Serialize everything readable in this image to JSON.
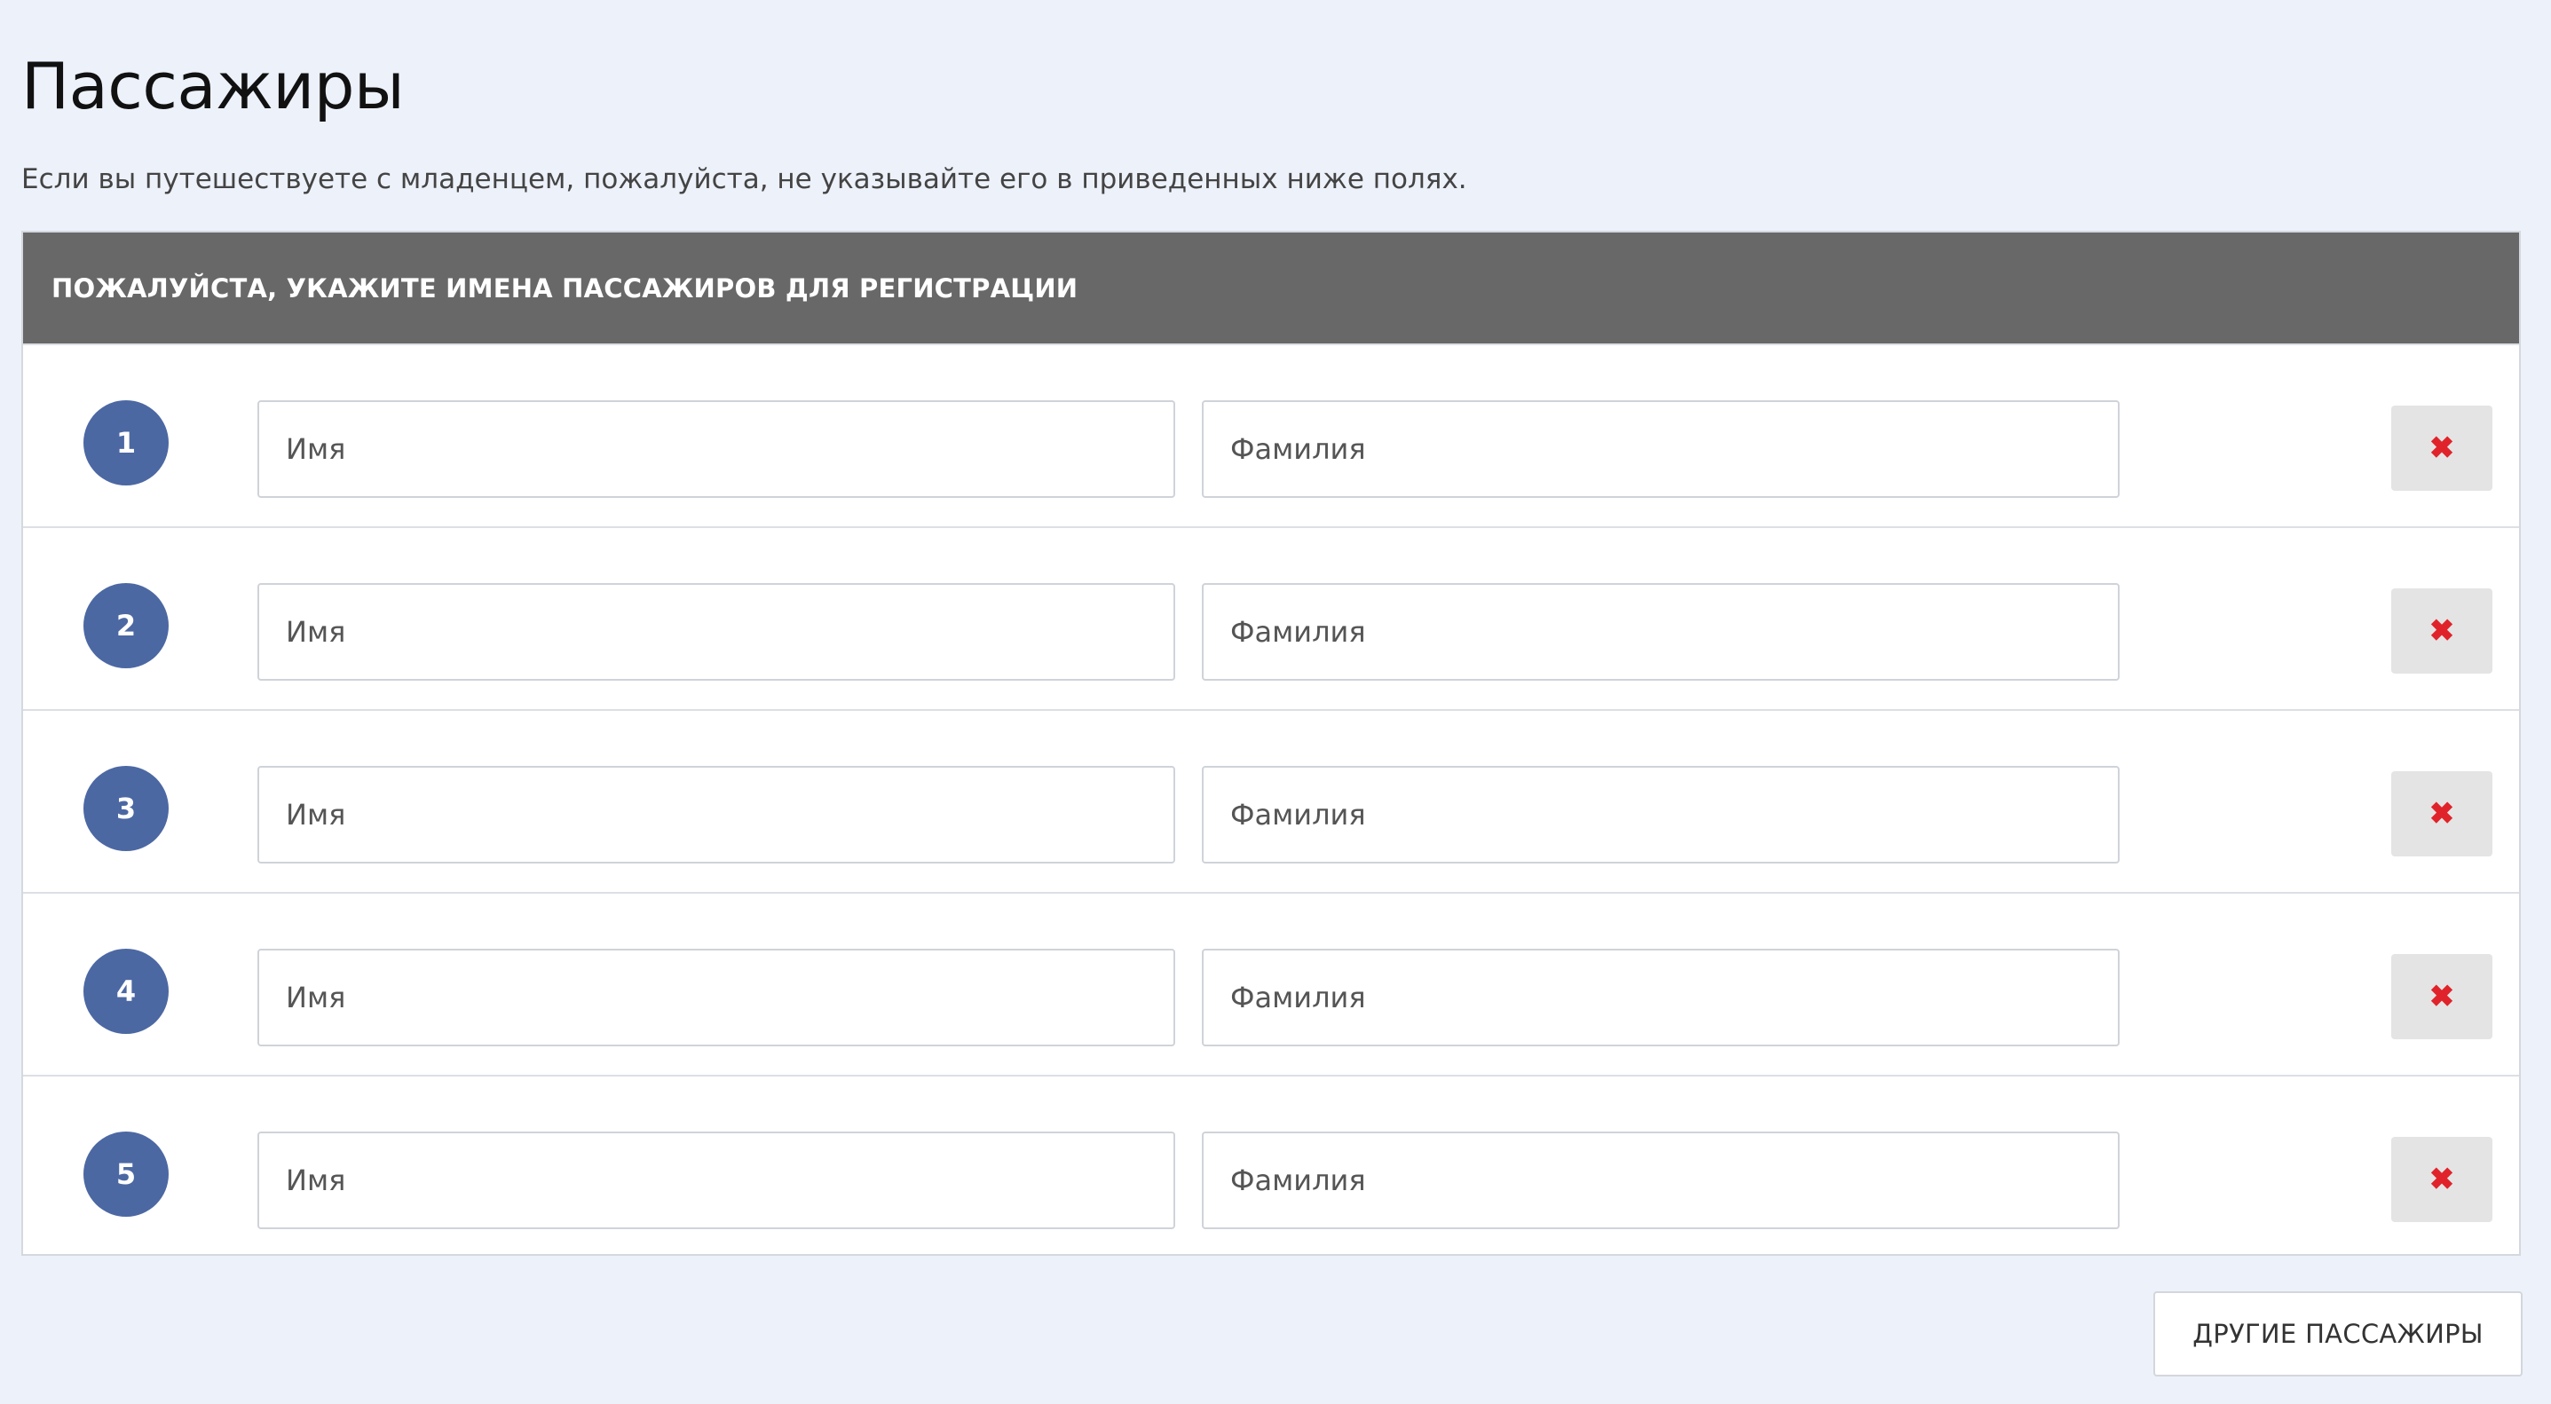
{
  "page": {
    "title": "Пассажиры",
    "subtitle": "Если вы путешествуете с младенцем, пожалуйста, не указывайте его в приведенных ниже полях."
  },
  "panel": {
    "header": "ПОЖАЛУЙСТА, УКАЖИТЕ ИМЕНА ПАССАЖИРОВ ДЛЯ РЕГИСТРАЦИИ",
    "rows": [
      {
        "number": "1",
        "first_placeholder": "Имя",
        "last_placeholder": "Фамилия",
        "first_value": "",
        "last_value": ""
      },
      {
        "number": "2",
        "first_placeholder": "Имя",
        "last_placeholder": "Фамилия",
        "first_value": "",
        "last_value": ""
      },
      {
        "number": "3",
        "first_placeholder": "Имя",
        "last_placeholder": "Фамилия",
        "first_value": "",
        "last_value": ""
      },
      {
        "number": "4",
        "first_placeholder": "Имя",
        "last_placeholder": "Фамилия",
        "first_value": "",
        "last_value": ""
      },
      {
        "number": "5",
        "first_placeholder": "Имя",
        "last_placeholder": "Фамилия",
        "first_value": "",
        "last_value": ""
      }
    ]
  },
  "icons": {
    "remove": "close-icon",
    "remove_glyph": "✖"
  },
  "colors": {
    "background": "#edf1fa",
    "header_bg": "#686868",
    "badge": "#4c68a3",
    "remove_icon": "#e0232a"
  },
  "actions": {
    "more_passengers": "ДРУГИЕ ПАССАЖИРЫ"
  }
}
